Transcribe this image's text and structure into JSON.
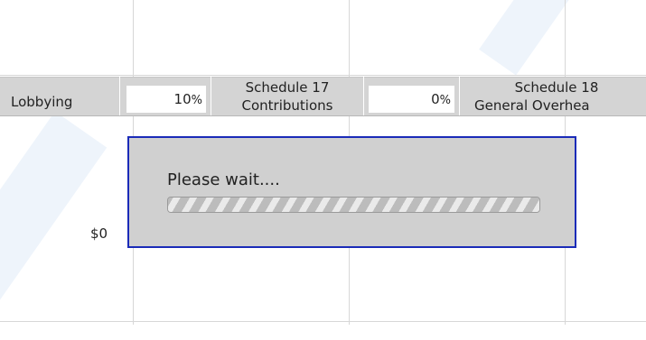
{
  "table": {
    "lobbying_label": "Lobbying",
    "lobbying_pct": "10",
    "pct_sign": "%",
    "schedule17_line1": "Schedule 17",
    "schedule17_line2": "Contributions",
    "schedule17_pct": "0",
    "schedule18_line1": "Schedule 18",
    "schedule18_line2": "General Overhea",
    "lobbying_amount": "$0"
  },
  "dialog": {
    "message": "Please wait....",
    "progress_fraction": 1.0
  },
  "colors": {
    "dialog_border": "#1a2bb8",
    "dialog_bg": "#d0d0d0",
    "header_bg": "#d4d4d4"
  }
}
